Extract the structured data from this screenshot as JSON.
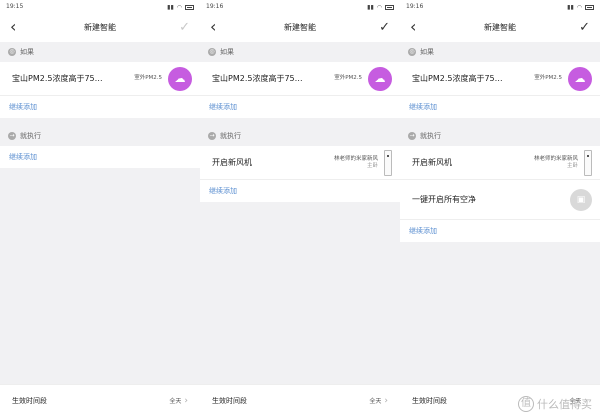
{
  "screens": [
    {
      "time": "19:15",
      "title": "新建智能",
      "if_label": "如果",
      "condition": {
        "text": "宝山PM2.5浓度高于75…",
        "sub": "室外PM2.5"
      },
      "add_condition": "继续添加",
      "then_label": "就执行",
      "add_action": "继续添加",
      "footer_label": "生效时间段",
      "footer_value": "全天"
    },
    {
      "time": "19:16",
      "title": "新建智能",
      "if_label": "如果",
      "condition": {
        "text": "宝山PM2.5浓度高于75…",
        "sub": "室外PM2.5"
      },
      "add_condition": "继续添加",
      "then_label": "就执行",
      "action1": {
        "text": "开启新风机",
        "sub1": "林老师的米家新风",
        "sub2": "主卧"
      },
      "add_action": "继续添加",
      "footer_label": "生效时间段",
      "footer_value": "全天"
    },
    {
      "time": "19:16",
      "title": "新建智能",
      "if_label": "如果",
      "condition": {
        "text": "宝山PM2.5浓度高于75…",
        "sub": "室外PM2.5"
      },
      "add_condition": "继续添加",
      "then_label": "就执行",
      "action1": {
        "text": "开启新风机",
        "sub1": "林老师的米家新风",
        "sub2": "主卧"
      },
      "action2": {
        "text": "一键开启所有空净"
      },
      "add_action": "继续添加",
      "footer_label": "生效时间段",
      "footer_value": "全天"
    }
  ],
  "watermark": "什么值得买",
  "colors": {
    "accent_pink": "#c65ce0",
    "link_blue": "#5a8ed0"
  }
}
